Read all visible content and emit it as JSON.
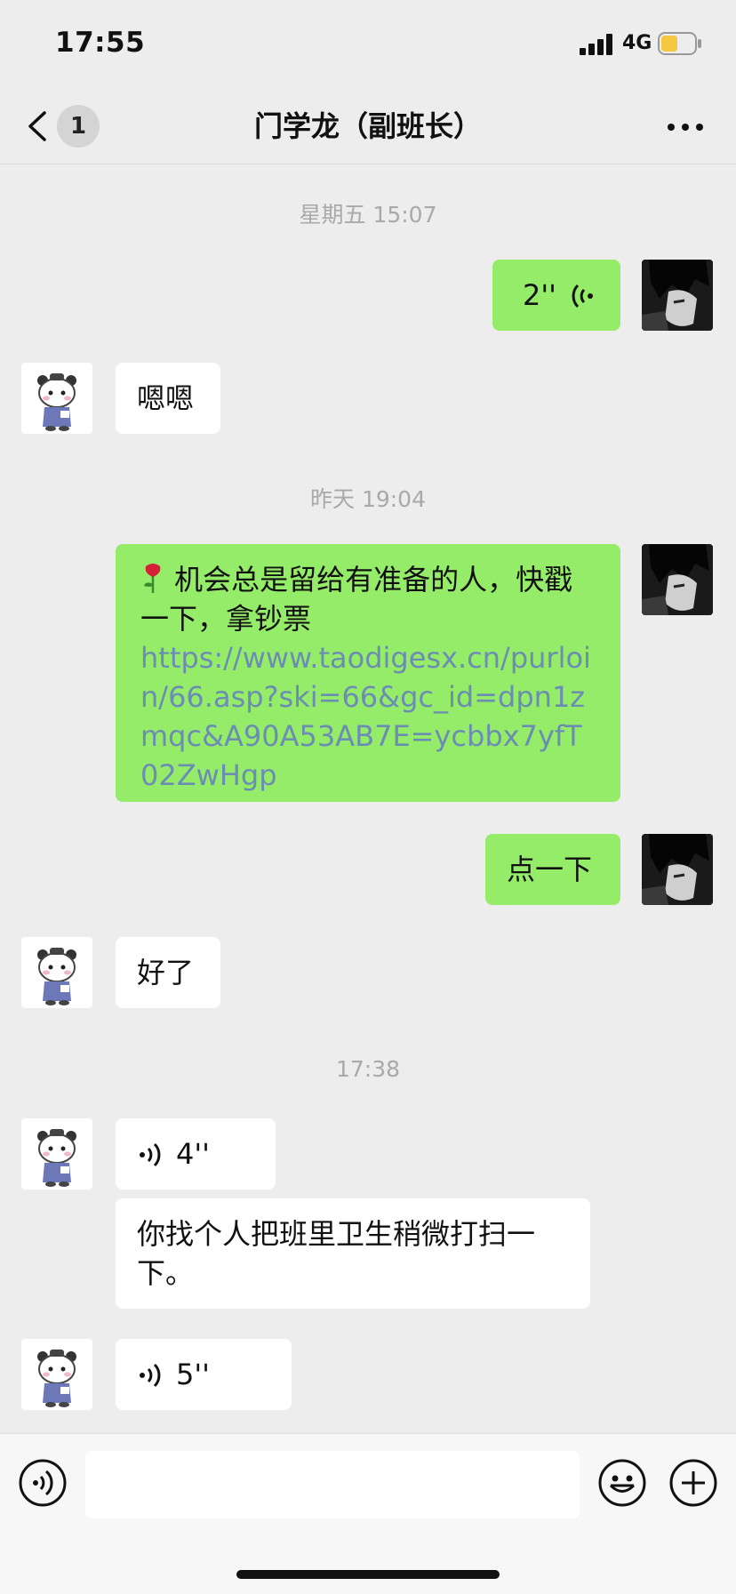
{
  "status": {
    "time": "17:55",
    "network": "4G",
    "battery_color": "#f5c842"
  },
  "nav": {
    "unread_count": "1",
    "title": "门学龙（副班长）"
  },
  "messages": {
    "ts1": "星期五 15:07",
    "voice_me_1": "2''",
    "reply_1": "嗯嗯",
    "ts2": "昨天 19:04",
    "promo_text": "机会总是留给有准备的人，快戳一下，拿钞票",
    "promo_link": "https://www.taodigesx.cn/purloin/66.asp?ski=66&gc_id=dpn1zmqc&A90A53AB7E=ycbbx7yfT02ZwHgp",
    "click_text": "点一下",
    "reply_2": "好了",
    "ts3": "17:38",
    "voice_other_1": "4''",
    "instruction": "你找个人把班里卫生稍微打扫一下。",
    "voice_other_2": "5''"
  },
  "colors": {
    "bubble_self": "#95ec69",
    "bubble_other": "#ffffff",
    "background": "#ededed",
    "link": "#6b8db3"
  },
  "icons": [
    "back-icon",
    "more-icon",
    "voice-wave-icon",
    "rose-icon",
    "voice-input-icon",
    "emoji-icon",
    "add-icon"
  ]
}
